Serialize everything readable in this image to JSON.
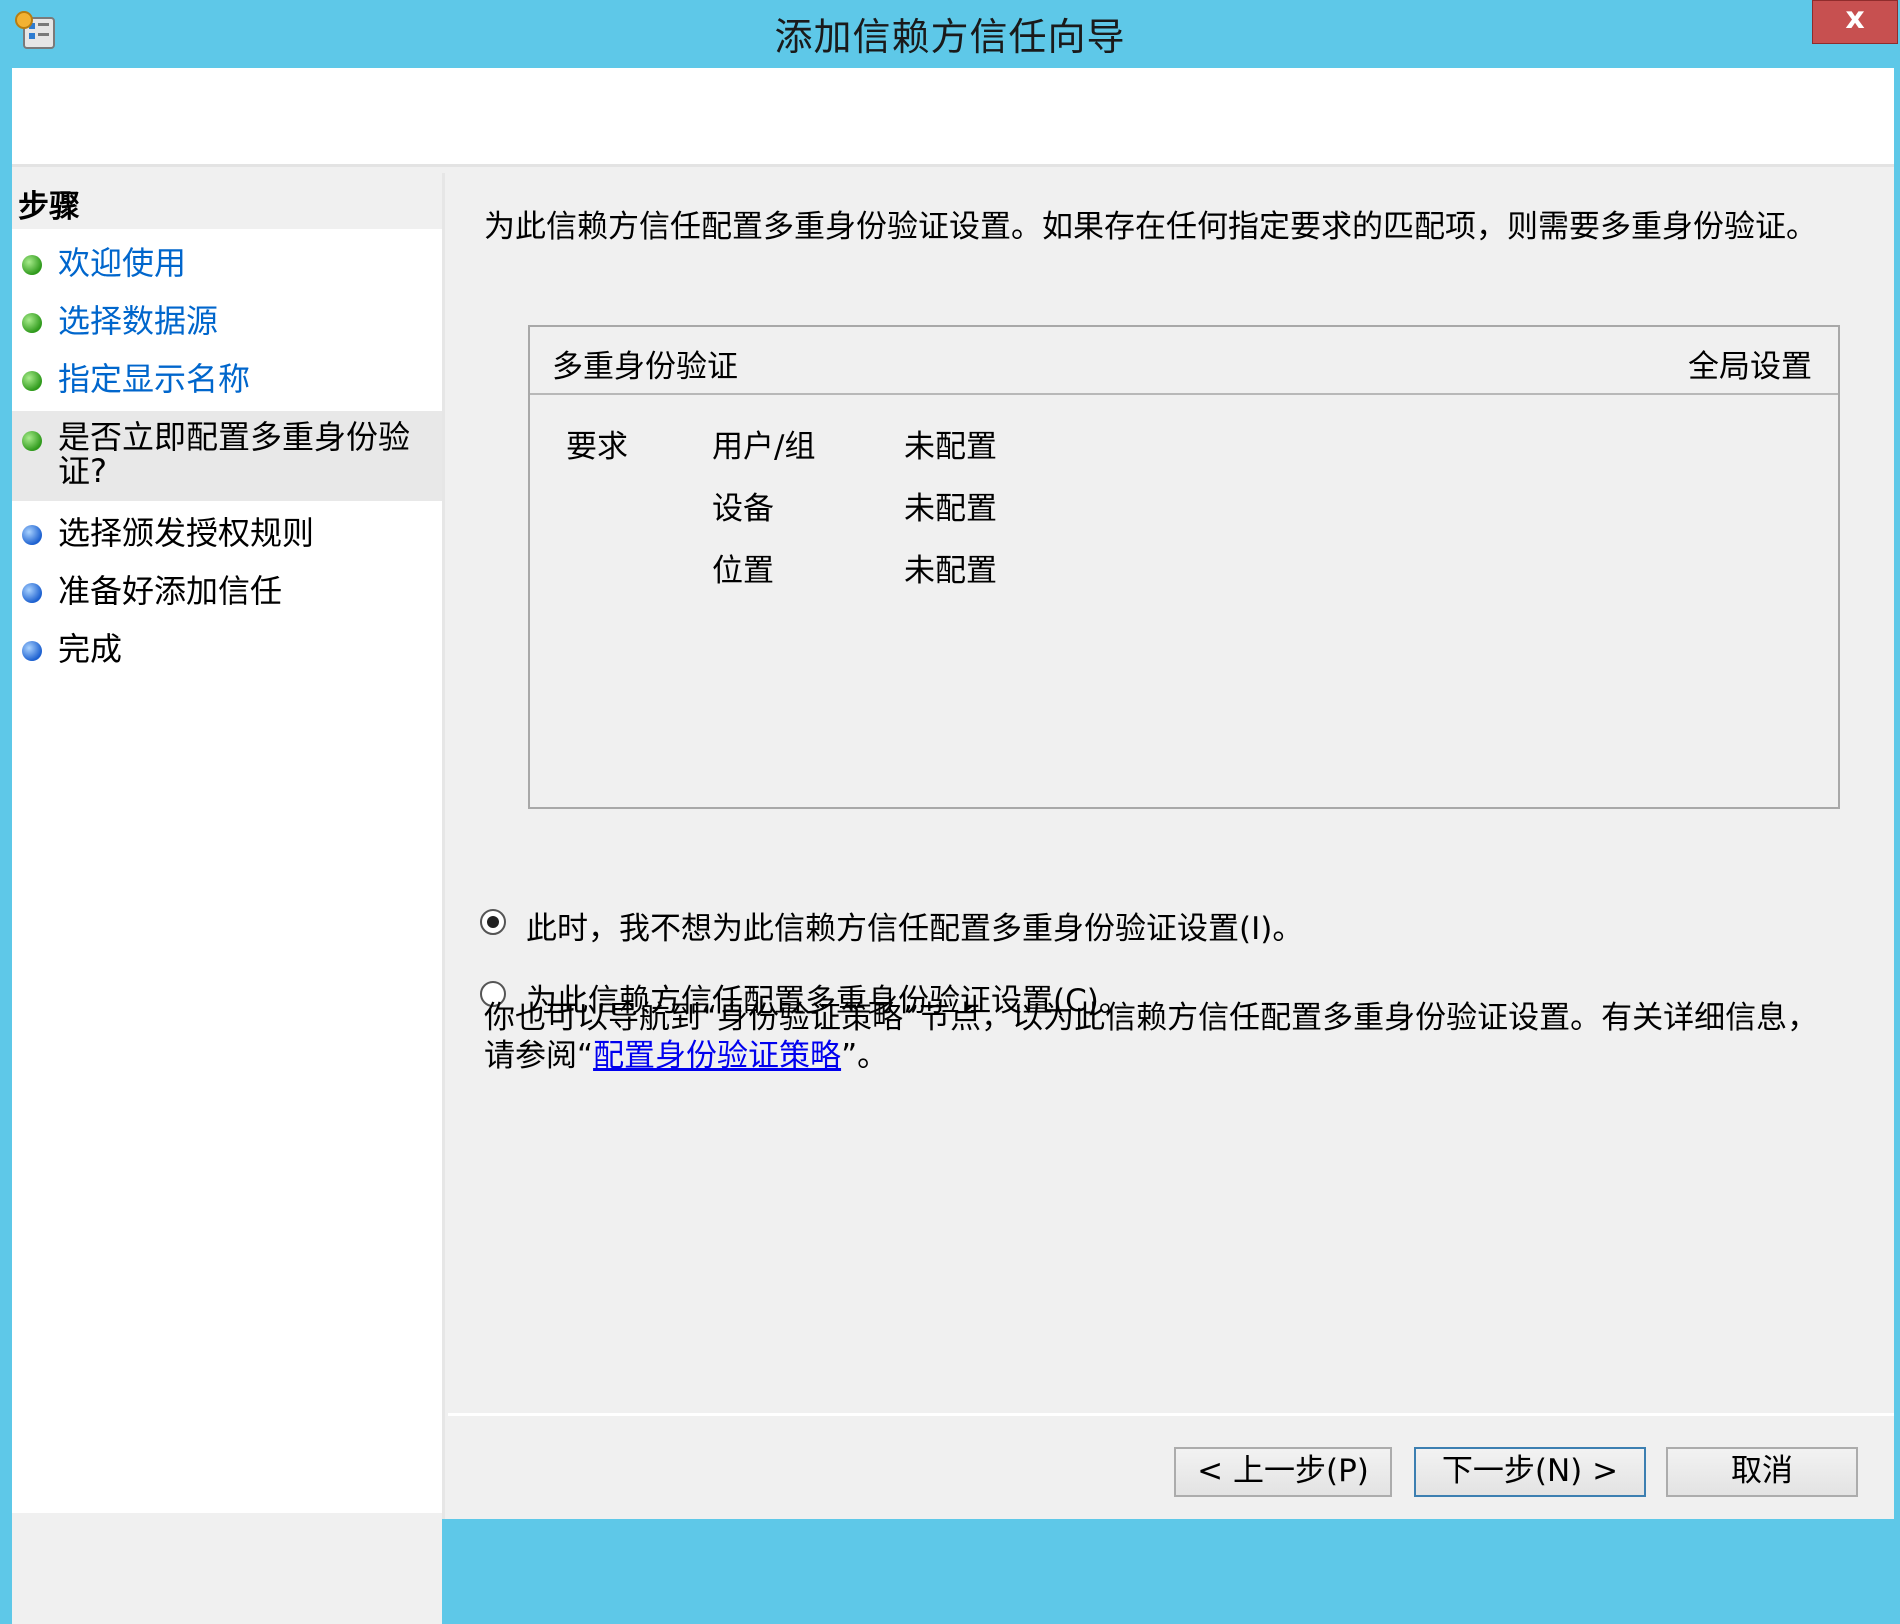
{
  "window": {
    "title": "添加信赖方信任向导",
    "close_label": "x"
  },
  "steps": {
    "title": "步骤",
    "items": [
      {
        "label": "欢迎使用",
        "state": "done"
      },
      {
        "label": "选择数据源",
        "state": "done"
      },
      {
        "label": "指定显示名称",
        "state": "done"
      },
      {
        "label": "是否立即配置多重身份验证?",
        "label_line1": "是否立即配置多重身份验",
        "label_line2": "证?",
        "state": "current"
      },
      {
        "label": "选择颁发授权规则",
        "state": "pending"
      },
      {
        "label": "准备好添加信任",
        "state": "pending"
      },
      {
        "label": "完成",
        "state": "pending"
      }
    ]
  },
  "main": {
    "description": "为此信赖方信任配置多重身份验证设置。如果存在任何指定要求的匹配项，则需要多重身份验证。",
    "mfa_box": {
      "title": "多重身份验证",
      "global_label": "全局设置",
      "requirement_label": "要求",
      "rows": [
        {
          "name": "用户/组",
          "value": "未配置"
        },
        {
          "name": "设备",
          "value": "未配置"
        },
        {
          "name": "位置",
          "value": "未配置"
        }
      ]
    },
    "options": [
      {
        "label": "此时，我不想为此信赖方信任配置多重身份验证设置(I)。",
        "selected": true
      },
      {
        "label": "为此信赖方信任配置多重身份验证设置(C)。",
        "selected": false
      }
    ],
    "info": {
      "prefix": "你也可以导航到“身份验证策略”节点，以为此信赖方信任配置多重身份验证设置。有关详细信息，请参阅“",
      "link": "配置身份验证策略",
      "suffix": "”。"
    }
  },
  "buttons": {
    "back": "< 上一步(P)",
    "next": "下一步(N) >",
    "cancel": "取消"
  },
  "colors": {
    "frame": "#5ec8e8",
    "link": "#0066cc",
    "done_dot": "#2f9a1c",
    "pending_dot": "#1d61d0"
  }
}
